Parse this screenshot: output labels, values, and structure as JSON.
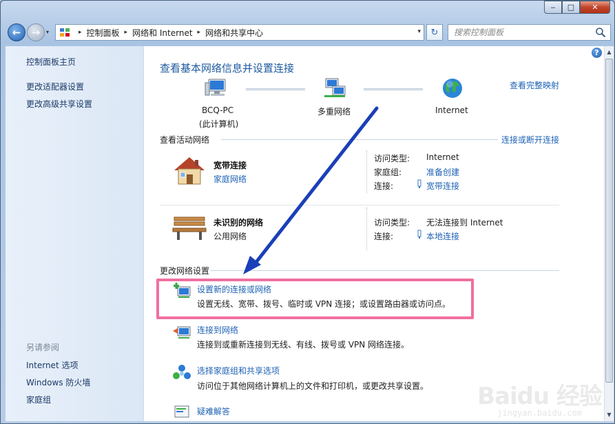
{
  "window": {
    "minimize_glyph": "‒",
    "maximize_glyph": "□",
    "close_glyph": "✕"
  },
  "nav": {
    "back_glyph": "←",
    "forward_glyph": "→",
    "history_glyph": "▾",
    "breadcrumbs": [
      "控制面板",
      "网络和 Internet",
      "网络和共享中心"
    ],
    "separator": "▸",
    "dropdown_glyph": "▾",
    "refresh_glyph": "↻",
    "search_placeholder": "搜索控制面板"
  },
  "sidebar": {
    "top_links": [
      "控制面板主页",
      "更改适配器设置",
      "更改高级共享设置"
    ],
    "see_also_heading": "另请参阅",
    "see_also_links": [
      "Internet 选项",
      "Windows 防火墙",
      "家庭组"
    ]
  },
  "main": {
    "help_glyph": "?",
    "title": "查看基本网络信息并设置连接",
    "view_full_map": "查看完整映射",
    "map": {
      "computer_name": "BCQ-PC",
      "computer_sub": "(此计算机)",
      "middle": "多重网络",
      "internet": "Internet"
    },
    "active_networks_label": "查看活动网络",
    "connect_disconnect": "连接或断开连接",
    "networks": [
      {
        "name": "宽带连接",
        "type": "家庭网络",
        "access_label": "访问类型:",
        "access_value": "Internet",
        "homegroup_label": "家庭组:",
        "homegroup_value": "准备创建",
        "connection_label": "连接:",
        "connection_value": "宽带连接"
      },
      {
        "name": "未识别的网络",
        "type": "公用网络",
        "access_label": "访问类型:",
        "access_value": "无法连接到 Internet",
        "connection_label": "连接:",
        "connection_value": "本地连接"
      }
    ],
    "change_settings_label": "更改网络设置",
    "tasks": [
      {
        "title": "设置新的连接或网络",
        "desc": "设置无线、宽带、拨号、临时或 VPN 连接；或设置路由器或访问点。"
      },
      {
        "title": "连接到网络",
        "desc": "连接到或重新连接到无线、有线、拨号或 VPN 网络连接。"
      },
      {
        "title": "选择家庭组和共享选项",
        "desc": "访问位于其他网络计算机上的文件和打印机，或更改共享设置。"
      },
      {
        "title": "疑难解答",
        "desc": ""
      }
    ]
  },
  "colors": {
    "highlight_border": "#f06fa0",
    "arrow": "#1a3fb8",
    "link": "#1f63b5"
  },
  "watermark": {
    "main": "Baidu 经验",
    "sub": "jingyan.baidu.com"
  }
}
